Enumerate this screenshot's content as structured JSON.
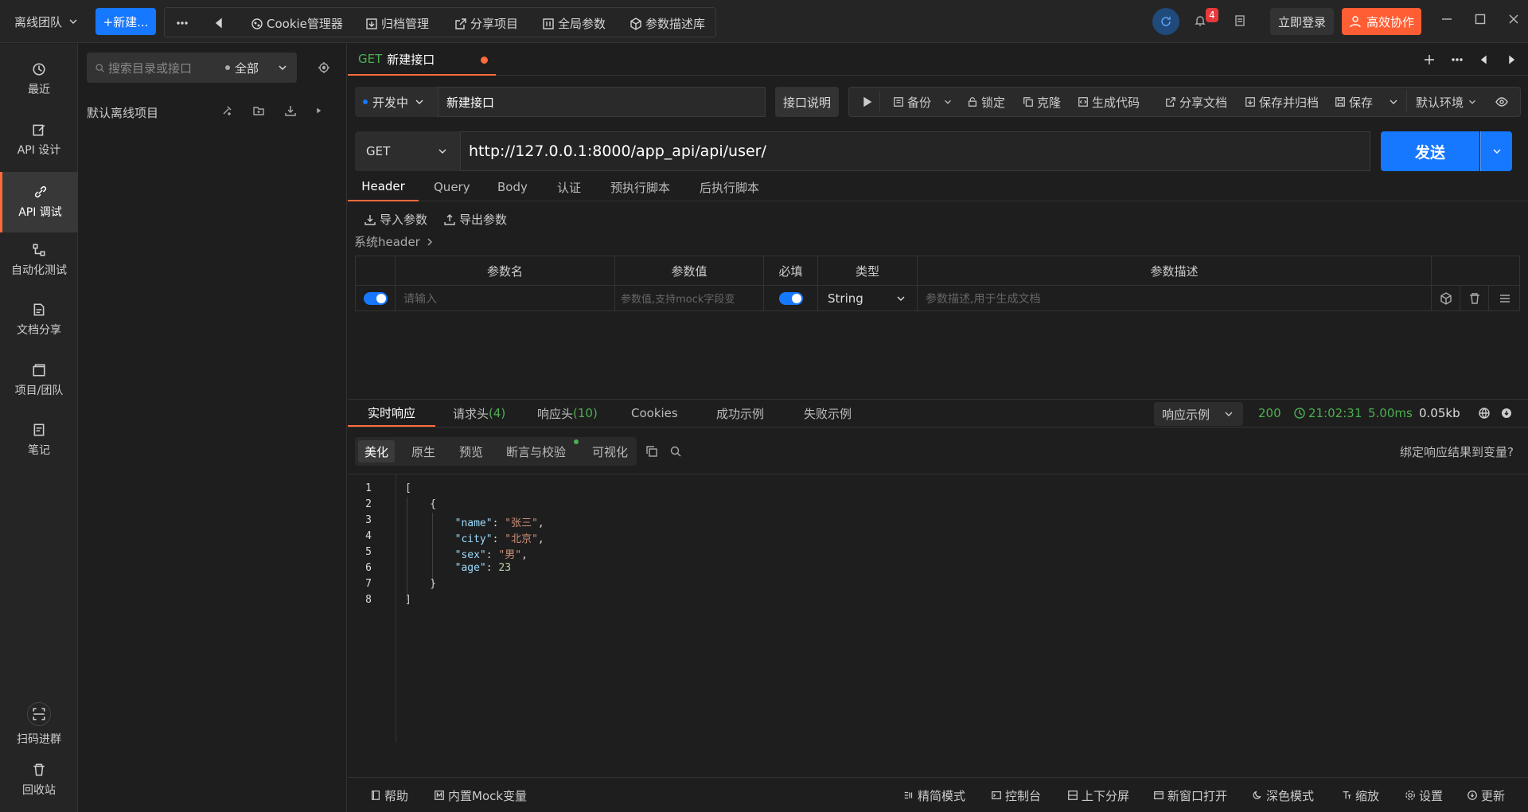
{
  "topbar": {
    "team": "离线团队",
    "new_button": "+新建...",
    "tools": [
      "Cookie管理器",
      "归档管理",
      "分享项目",
      "全局参数",
      "参数描述库"
    ],
    "notification_count": "4",
    "login": "立即登录",
    "collab": "高效协作"
  },
  "leftnav": {
    "items": [
      {
        "label": "最近",
        "icon": "history-icon"
      },
      {
        "label": "API 设计",
        "icon": "edit-icon"
      },
      {
        "label": "API 调试",
        "icon": "link-icon"
      },
      {
        "label": "自动化测试",
        "icon": "flow-icon"
      },
      {
        "label": "文档分享",
        "icon": "doc-icon"
      },
      {
        "label": "项目/团队",
        "icon": "folder-icon"
      },
      {
        "label": "笔记",
        "icon": "note-icon"
      }
    ],
    "bottom": [
      {
        "label": "扫码进群",
        "icon": "scan-icon"
      },
      {
        "label": "回收站",
        "icon": "trash-icon"
      }
    ]
  },
  "tree": {
    "search_placeholder": "搜索目录或接口",
    "filter": "全部",
    "root": "默认离线项目"
  },
  "tab": {
    "method": "GET",
    "title": "新建接口"
  },
  "request": {
    "status": "开发中",
    "name": "新建接口",
    "doc_button": "接口说明",
    "actions": [
      "备份",
      "锁定",
      "克隆",
      "生成代码",
      "分享文档",
      "保存并归档",
      "保存"
    ],
    "environment": "默认环境",
    "method": "GET",
    "url": "http://127.0.0.1:8000/app_api/api/user/",
    "send": "发送",
    "tabs": [
      "Header",
      "Query",
      "Body",
      "认证",
      "预执行脚本",
      "后执行脚本"
    ],
    "import_params": "导入参数",
    "export_params": "导出参数",
    "system_header": "系统header"
  },
  "param_table": {
    "columns": [
      "参数名",
      "参数值",
      "必填",
      "类型",
      "参数描述"
    ],
    "row": {
      "name_placeholder": "请输入",
      "value_placeholder": "参数值,支持mock字段变",
      "type": "String",
      "desc_placeholder": "参数描述,用于生成文档"
    }
  },
  "response": {
    "tabs": [
      {
        "label": "实时响应",
        "count": ""
      },
      {
        "label": "请求头",
        "count": "(4)"
      },
      {
        "label": "响应头",
        "count": "(10)"
      },
      {
        "label": "Cookies",
        "count": ""
      },
      {
        "label": "成功示例",
        "count": ""
      },
      {
        "label": "失败示例",
        "count": ""
      }
    ],
    "example_select": "响应示例",
    "status_code": "200",
    "time": "21:02:31",
    "duration": "5.00ms",
    "size": "0.05kb",
    "view_tabs": [
      "美化",
      "原生",
      "预览",
      "断言与校验",
      "可视化"
    ],
    "bind_link": "绑定响应结果到变量?",
    "code_lines": [
      {
        "n": "1",
        "t": "["
      },
      {
        "n": "2",
        "t": "    {"
      },
      {
        "n": "3",
        "k": "\"name\"",
        "v": "\"张三\"",
        "end": ","
      },
      {
        "n": "4",
        "k": "\"city\"",
        "v": "\"北京\"",
        "end": ","
      },
      {
        "n": "5",
        "k": "\"sex\"",
        "v": "\"男\"",
        "end": ","
      },
      {
        "n": "6",
        "k": "\"age\"",
        "v": "23",
        "end": ""
      },
      {
        "n": "7",
        "t": "    }"
      },
      {
        "n": "8",
        "t": "]"
      }
    ]
  },
  "footer": {
    "left": [
      "帮助",
      "内置Mock变量"
    ],
    "right": [
      "精简模式",
      "控制台",
      "上下分屏",
      "新窗口打开",
      "深色模式",
      "缩放",
      "设置",
      "更新"
    ]
  },
  "colors": {
    "accent": "#ff6b3b",
    "primary": "#1677ff",
    "success": "#4caf50",
    "collab": "#ff5e34"
  }
}
